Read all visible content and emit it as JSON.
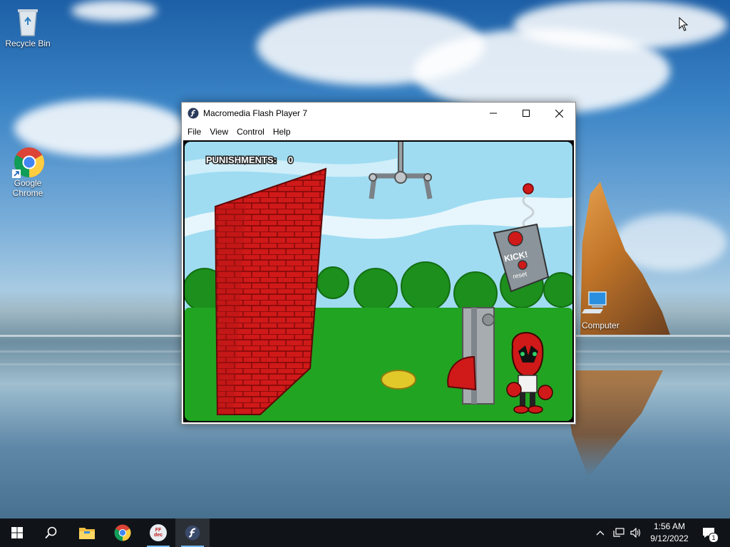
{
  "desktop": {
    "icons": [
      {
        "label": "Recycle Bin",
        "icon": "recycle-bin-icon"
      },
      {
        "label": "Google Chrome",
        "icon": "chrome-icon"
      },
      {
        "label": "Computer",
        "icon": "computer-icon"
      }
    ]
  },
  "window": {
    "title": "Macromedia Flash Player 7",
    "menu": [
      "File",
      "View",
      "Control",
      "Help"
    ],
    "controls": [
      "minimize-icon",
      "maximize-icon",
      "close-icon"
    ]
  },
  "game": {
    "punishments_label": "PUNISHMENTS:",
    "punishments_value": "0",
    "kick_label": "KICK!",
    "reset_label": "reset"
  },
  "taskbar": {
    "apps": [
      "start-icon",
      "search-icon",
      "file-explorer-icon",
      "chrome-icon",
      "ffdec-icon",
      "flash-player-icon"
    ],
    "ffdec_label": "FF dec",
    "time": "1:56 AM",
    "date": "9/12/2022",
    "notification_count": "1"
  },
  "colors": {
    "taskbar": "#101418",
    "accent": "#76b9ed",
    "sky": "#9fdcf2",
    "grass": "#21a422",
    "brick": "#d21a1a"
  }
}
